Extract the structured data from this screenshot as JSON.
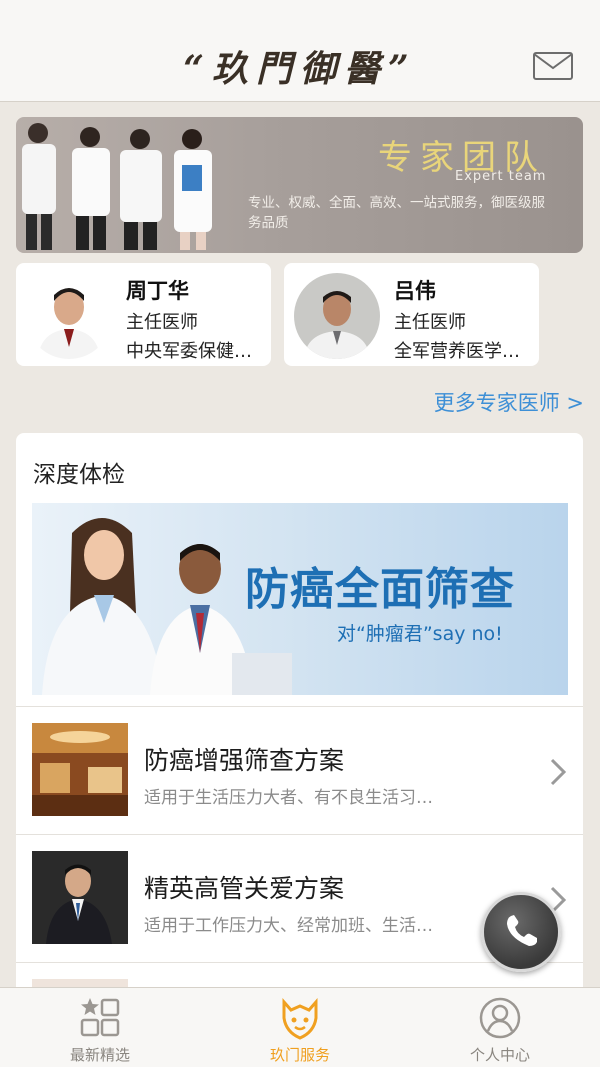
{
  "header": {
    "logo_text": "“玖門御醫”",
    "icons": {
      "mail": "mail-icon"
    }
  },
  "expert_banner": {
    "title": "专家团队",
    "subtitle": "Expert team",
    "description": "专业、权威、全面、高效、一站式服务，御医级服务品质"
  },
  "doctors": [
    {
      "name": "周丁华",
      "title": "主任医师",
      "org": "中央军委保健…"
    },
    {
      "name": "吕伟",
      "title": "主任医师",
      "org": "全军营养医学…"
    }
  ],
  "more_experts_label": "更多专家医师 >",
  "checkup": {
    "section_title": "深度体检",
    "banner_title": "防癌全面筛查",
    "banner_sub": "对“肿瘤君”say no!",
    "plans": [
      {
        "title": "防癌增强筛查方案",
        "desc": "适用于生活压力大者、有不良生活习…"
      },
      {
        "title": "精英高管关爱方案",
        "desc": "适用于工作压力大、经常加班、生活…"
      },
      {
        "title": "",
        "desc": ""
      }
    ]
  },
  "tabs": [
    {
      "label": "最新精选",
      "icon": "grid-star-icon",
      "active": false
    },
    {
      "label": "玖门服务",
      "icon": "service-badge-icon",
      "active": true
    },
    {
      "label": "个人中心",
      "icon": "user-icon",
      "active": false
    }
  ],
  "colors": {
    "accent": "#f0a020",
    "link": "#3d8fd6",
    "banner_gold": "#e9d57a",
    "banner_blue": "#1e6fb4"
  }
}
